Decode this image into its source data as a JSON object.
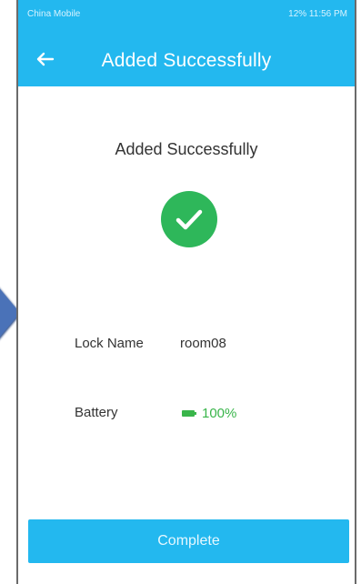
{
  "status_bar": {
    "carrier": "China Mobile",
    "right_text": "12% 11:56 PM"
  },
  "header": {
    "title": "Added Successfully",
    "back_icon": "arrow-left-icon"
  },
  "content": {
    "title": "Added Successfully",
    "success_icon": "check-circle-icon"
  },
  "lock": {
    "name_label": "Lock Name",
    "name_value": "room08",
    "battery_label": "Battery",
    "battery_value": "100%"
  },
  "actions": {
    "complete_label": "Complete"
  },
  "colors": {
    "primary": "#23b8ef",
    "success": "#2eb75a",
    "battery": "#39b54a"
  }
}
